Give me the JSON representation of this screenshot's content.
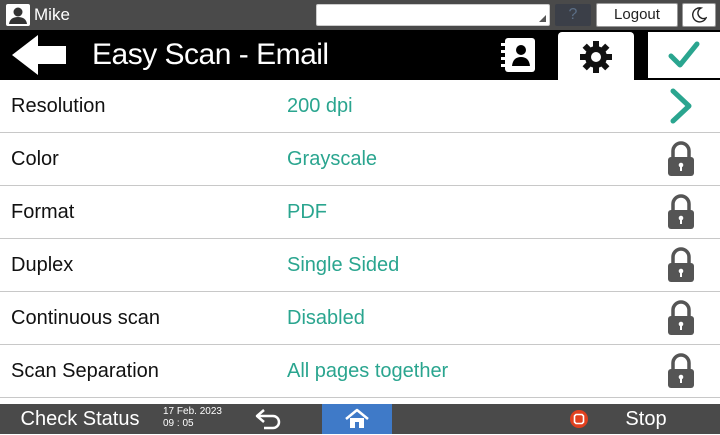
{
  "topbar": {
    "user_name": "Mike",
    "help_label": "?",
    "logout_label": "Logout"
  },
  "header": {
    "title": "Easy Scan - Email"
  },
  "rows": [
    {
      "label": "Resolution",
      "value": "200 dpi",
      "action": "chevron-right"
    },
    {
      "label": "Color",
      "value": "Grayscale",
      "action": "lock"
    },
    {
      "label": "Format",
      "value": "PDF",
      "action": "lock"
    },
    {
      "label": "Duplex",
      "value": "Single Sided",
      "action": "lock"
    },
    {
      "label": "Continuous scan",
      "value": "Disabled",
      "action": "lock"
    },
    {
      "label": "Scan Separation",
      "value": "All pages together",
      "action": "lock"
    }
  ],
  "bottombar": {
    "check_status_label": "Check Status",
    "date": "17 Feb. 2023",
    "time": "09 : 05",
    "stop_label": "Stop"
  },
  "colors": {
    "accent": "#2aa58f",
    "bar_bg": "#4a4a4a",
    "header_bg": "#000000",
    "home_bg": "#3f7ac8",
    "stop": "#e0401f"
  }
}
